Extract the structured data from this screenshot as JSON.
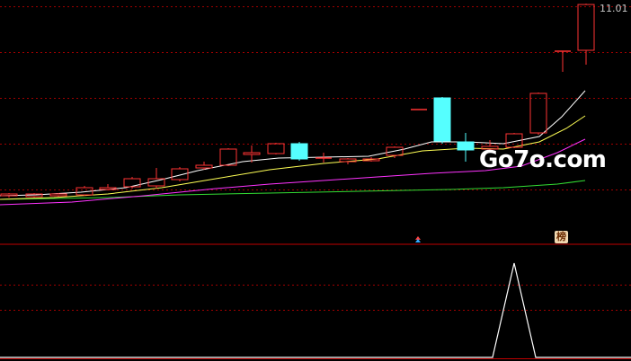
{
  "price_panel": {
    "last_price_label": "11.01",
    "watermark_text": "Go7o.com",
    "badge_text": "榜",
    "colors": {
      "up_candle": "#ff3333",
      "down_candle": "#55ffff",
      "ma_fast": "#ffffff",
      "ma_mid": "#ffff55",
      "ma_slow": "#ff33ff",
      "ma_long": "#33dd33",
      "grid": "#a00000"
    }
  },
  "indicator_panel": {
    "line_color": "#ffffff",
    "signal": "peak"
  }
}
